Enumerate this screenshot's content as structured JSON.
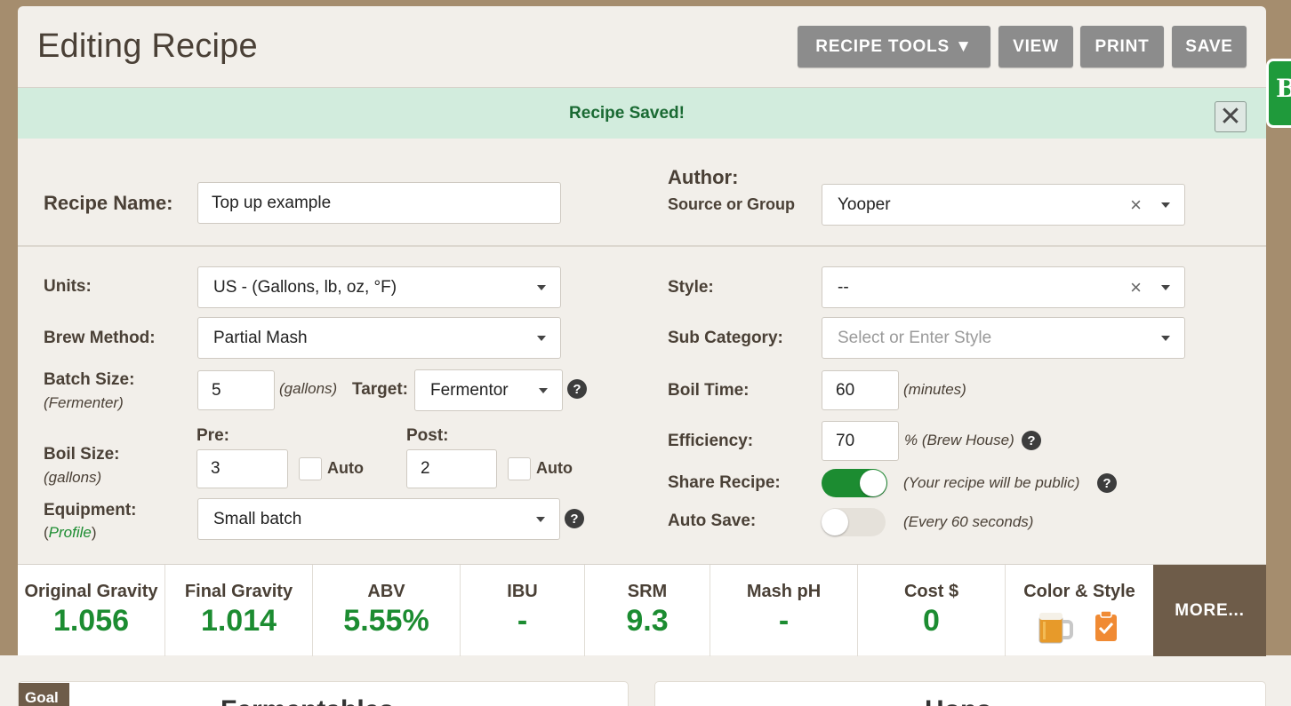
{
  "header": {
    "title": "Editing Recipe",
    "buttons": {
      "recipe_tools": "RECIPE TOOLS ▼",
      "view": "VIEW",
      "print": "PRINT",
      "save": "SAVE"
    }
  },
  "alert": {
    "text": "Recipe Saved!",
    "close_glyph": "✕"
  },
  "form": {
    "recipe_name": {
      "label": "Recipe Name:",
      "value": "Top up example"
    },
    "author": {
      "label": "Author:",
      "sublabel": "Source or Group",
      "value": "Yooper",
      "clear": "×"
    },
    "units": {
      "label": "Units:",
      "value": "US - (Gallons, lb, oz, °F)"
    },
    "style": {
      "label": "Style:",
      "value": "--",
      "clear": "×"
    },
    "brew_method": {
      "label": "Brew Method:",
      "value": "Partial Mash"
    },
    "sub_category": {
      "label": "Sub Category:",
      "placeholder": "Select or Enter Style"
    },
    "batch_size": {
      "label": "Batch Size:",
      "sublabel": "(Fermenter)",
      "value": "5",
      "unit": "(gallons)",
      "target_label": "Target:",
      "target_value": "Fermentor"
    },
    "boil_time": {
      "label": "Boil Time:",
      "value": "60",
      "unit": "(minutes)"
    },
    "boil_size": {
      "label": "Boil Size:",
      "sublabel": "(gallons)",
      "pre_label": "Pre:",
      "pre_value": "3",
      "post_label": "Post:",
      "post_value": "2",
      "auto_label": "Auto"
    },
    "efficiency": {
      "label": "Efficiency:",
      "value": "70",
      "unit": "% (Brew House)"
    },
    "share_recipe": {
      "label": "Share Recipe:",
      "note": "(Your recipe will be public)",
      "on": true
    },
    "auto_save": {
      "label": "Auto Save:",
      "note": "(Every 60 seconds)",
      "on": false
    },
    "equipment": {
      "label": "Equipment:",
      "paren_open": "(",
      "profile_link": "Profile",
      "paren_close": ")",
      "value": "Small batch"
    },
    "help_glyph": "?"
  },
  "stats": {
    "items": [
      {
        "label": "Original Gravity",
        "value": "1.056"
      },
      {
        "label": "Final Gravity",
        "value": "1.014"
      },
      {
        "label": "ABV",
        "value": "5.55%"
      },
      {
        "label": "IBU",
        "value": "-"
      },
      {
        "label": "SRM",
        "value": "9.3"
      },
      {
        "label": "Mash pH",
        "value": "-"
      },
      {
        "label": "Cost $",
        "value": "0"
      }
    ],
    "color_style_label": "Color & Style",
    "more": "MORE..."
  },
  "bottom": {
    "goal_tab": "Goal",
    "left_title": "Fermentables",
    "right_title": "Hops"
  },
  "colors": {
    "accent_green": "#1c8c31",
    "header_button": "#8c8c8c",
    "more_button": "#6e5c49",
    "alert_bg": "#d2ecdd"
  }
}
